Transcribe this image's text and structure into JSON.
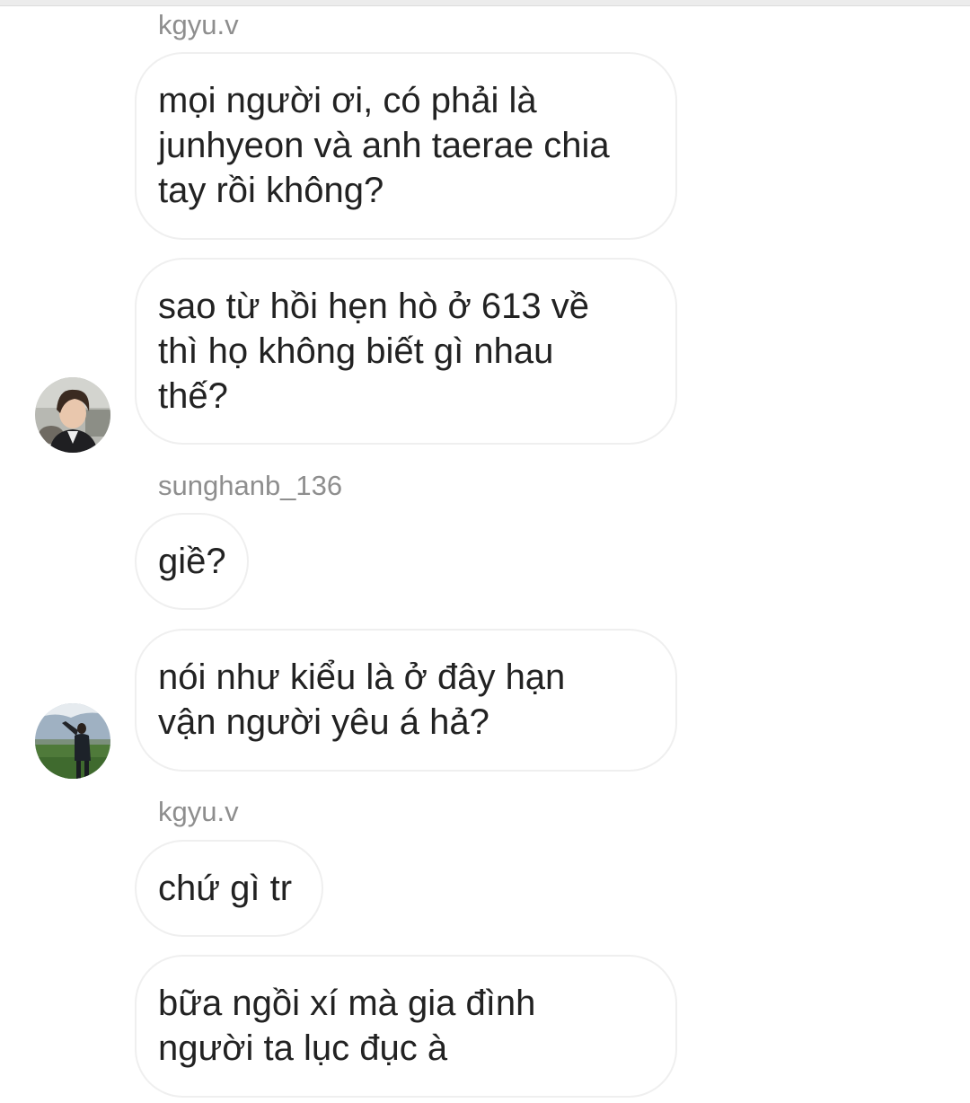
{
  "conversation": {
    "groups": [
      {
        "sender": "kgyu.v",
        "avatar_icon": "profile-photo-icon",
        "messages": [
          [
            "mọi người ơi, có phải là",
            "junhyeon và anh taerae chia",
            "tay rồi không?"
          ],
          [
            "sao từ hồi hẹn hò ở 613 về",
            "thì họ không biết gì nhau",
            "thế?"
          ]
        ]
      },
      {
        "sender": "sunghanb_136",
        "avatar_icon": "profile-photo-icon",
        "messages": [
          [
            "giề?"
          ],
          [
            "nói như kiểu là ở đây hạn",
            "vận người yêu á hả?"
          ]
        ]
      },
      {
        "sender": "kgyu.v",
        "messages": [
          [
            "chứ gì tr"
          ],
          [
            "bữa ngồi xí mà gia đình",
            "người ta lục đục à"
          ]
        ]
      }
    ]
  },
  "colors": {
    "background": "#ffffff",
    "bubble_border": "#efefef",
    "sender_name": "#8e8e8e",
    "message_text": "#222222"
  }
}
